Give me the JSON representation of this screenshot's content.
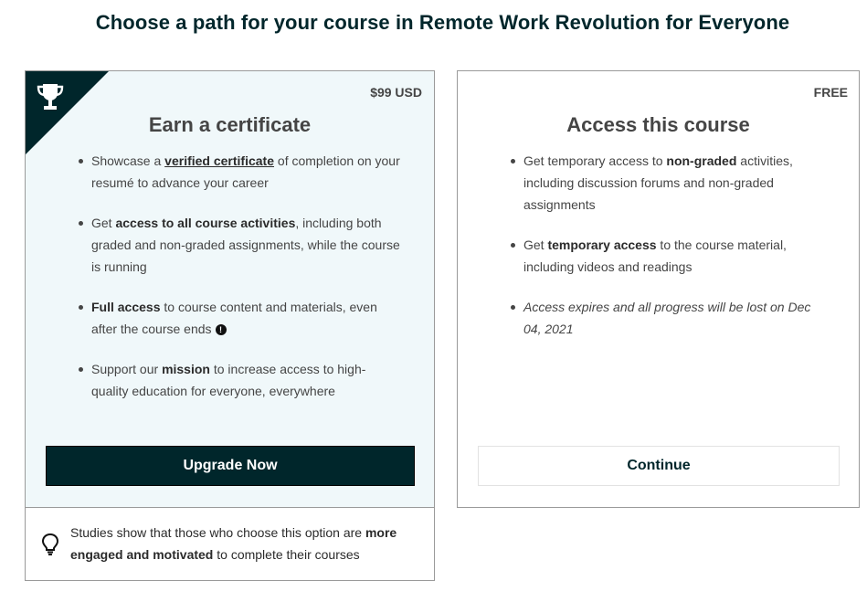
{
  "page": {
    "title": "Choose a path for your course in Remote Work Revolution for Everyone"
  },
  "verified": {
    "price": "$99 USD",
    "title": "Earn a certificate",
    "benefits": [
      {
        "pre": "Showcase a ",
        "bold": "verified certificate",
        "post": " of completion on your resumé to advance your career"
      },
      {
        "pre": "Get ",
        "bold": "access to all course activities",
        "post": ", including both graded and non-graded assignments, while the course is running"
      },
      {
        "pre": "",
        "bold": "Full access",
        "post": " to course content and materials, even after the course ends"
      },
      {
        "pre": "Support our ",
        "bold": "mission",
        "post": " to increase access to high-quality education for everyone, everywhere"
      }
    ],
    "info_glyph": "!",
    "button_label": "Upgrade Now",
    "tip": {
      "pre": "Studies show that those who choose this option are ",
      "bold": "more engaged and motivated",
      "post": " to complete their courses"
    }
  },
  "audit": {
    "price": "FREE",
    "title": "Access this course",
    "benefits": [
      {
        "pre": "Get temporary access to ",
        "bold": "non-graded",
        "post": " activities, including discussion forums and non-graded assignments"
      },
      {
        "pre": "Get ",
        "bold": "temporary access",
        "post": " to the course material, including videos and readings"
      }
    ],
    "expiry_note": "Access expires and all progress will be lost on Dec 04, 2021",
    "button_label": "Continue"
  },
  "colors": {
    "brand_dark": "#00262b",
    "card_bg": "#f0f8fa",
    "border": "#9a9a9a",
    "text": "#454545"
  },
  "icons": {
    "ribbon": "trophy-icon",
    "info": "info-icon",
    "tip": "lightbulb-icon"
  }
}
